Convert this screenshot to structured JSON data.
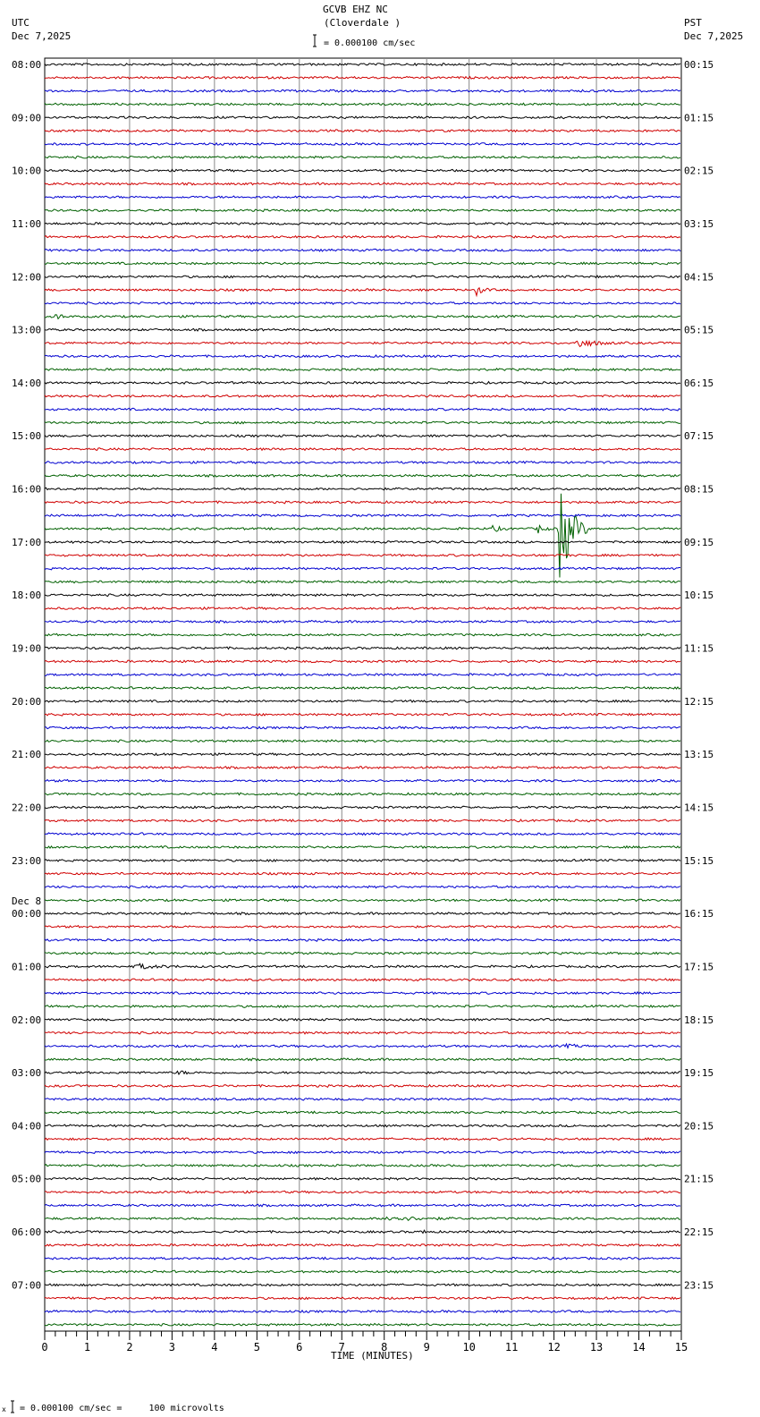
{
  "header": {
    "station": "GCVB EHZ NC",
    "location": "(Cloverdale )",
    "left_tz": "UTC",
    "left_date": "Dec 7,2025",
    "right_tz": "PST",
    "right_date": "Dec 7,2025",
    "scale_text": "= 0.000100 cm/sec"
  },
  "footer": {
    "scale_text": "= 0.000100 cm/sec =     100 microvolts",
    "marker": "x"
  },
  "chart_data": {
    "type": "line",
    "title": "GCVB EHZ NC (Cloverdale )",
    "xlabel": "TIME (MINUTES)",
    "xlim": [
      0,
      15
    ],
    "x_ticks": [
      "0",
      "1",
      "2",
      "3",
      "4",
      "5",
      "6",
      "7",
      "8",
      "9",
      "10",
      "11",
      "12",
      "13",
      "14",
      "15"
    ],
    "traces_per_hour": 4,
    "trace_colors": [
      "#000000",
      "#d00000",
      "#0000d0",
      "#006000"
    ],
    "left_labels": [
      "08:00",
      "09:00",
      "10:00",
      "11:00",
      "12:00",
      "13:00",
      "14:00",
      "15:00",
      "16:00",
      "17:00",
      "18:00",
      "19:00",
      "20:00",
      "21:00",
      "22:00",
      "23:00",
      "00:00",
      "01:00",
      "02:00",
      "03:00",
      "04:00",
      "05:00",
      "06:00",
      "07:00"
    ],
    "date_change": {
      "label": "Dec 8",
      "before_hour_index": 16
    },
    "right_labels": [
      "00:15",
      "01:15",
      "02:15",
      "03:15",
      "04:15",
      "05:15",
      "06:15",
      "07:15",
      "08:15",
      "09:15",
      "10:15",
      "11:15",
      "12:15",
      "13:15",
      "14:15",
      "15:15",
      "16:15",
      "17:15",
      "18:15",
      "19:15",
      "20:15",
      "21:15",
      "22:15",
      "23:15"
    ],
    "events": [
      {
        "trace": 17,
        "start_min": 10.1,
        "end_min": 10.5,
        "amplitude": 9
      },
      {
        "trace": 19,
        "start_min": 0.2,
        "end_min": 0.5,
        "amplitude": 8
      },
      {
        "trace": 21,
        "start_min": 12.5,
        "end_min": 13.5,
        "amplitude": 6
      },
      {
        "trace": 35,
        "start_min": 10.5,
        "end_min": 11.0,
        "amplitude": 4
      },
      {
        "trace": 35,
        "start_min": 11.6,
        "end_min": 11.9,
        "amplitude": 8
      },
      {
        "trace": 35,
        "start_min": 12.1,
        "end_min": 12.8,
        "amplitude": 75
      },
      {
        "trace": 68,
        "start_min": 2.1,
        "end_min": 3.3,
        "amplitude": 3
      },
      {
        "trace": 76,
        "start_min": 3.1,
        "end_min": 3.6,
        "amplitude": 2.5
      },
      {
        "trace": 87,
        "start_min": 8.0,
        "end_min": 9.9,
        "amplitude": 3
      },
      {
        "trace": 88,
        "start_min": 8.9,
        "end_min": 9.05,
        "amplitude": 5
      },
      {
        "trace": 74,
        "start_min": 12.2,
        "end_min": 13.0,
        "amplitude": 2
      }
    ]
  }
}
